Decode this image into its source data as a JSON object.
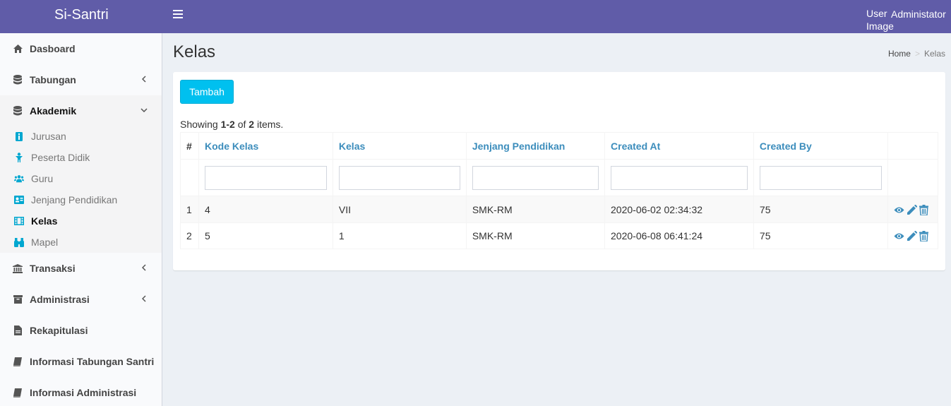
{
  "app": {
    "brand": "Si-Santri",
    "user_image_alt": "User Image",
    "user_name": "Administator"
  },
  "colors": {
    "header": "#605ca8",
    "accent": "#3c8dbc",
    "button": "#00c0ef"
  },
  "sidebar": {
    "items": [
      {
        "label": "Dasboard",
        "icon": "home-icon"
      },
      {
        "label": "Tabungan",
        "icon": "database-icon",
        "chevron": "left"
      },
      {
        "label": "Akademik",
        "icon": "database-icon",
        "chevron": "down"
      },
      {
        "label": "Transaksi",
        "icon": "bank-icon",
        "chevron": "left"
      },
      {
        "label": "Administrasi",
        "icon": "archive-icon",
        "chevron": "left"
      },
      {
        "label": "Rekapitulasi",
        "icon": "file-icon"
      },
      {
        "label": "Informasi Tabungan Santri",
        "icon": "book-icon"
      },
      {
        "label": "Informasi Administrasi",
        "icon": "book-icon"
      }
    ],
    "submenu": [
      {
        "label": "Jurusan",
        "icon": "info-icon"
      },
      {
        "label": "Peserta Didik",
        "icon": "child-icon"
      },
      {
        "label": "Guru",
        "icon": "users-icon"
      },
      {
        "label": "Jenjang Pendidikan",
        "icon": "id-card-icon"
      },
      {
        "label": "Kelas",
        "icon": "film-icon",
        "active": true
      },
      {
        "label": "Mapel",
        "icon": "binoculars-icon"
      }
    ]
  },
  "page": {
    "title": "Kelas",
    "breadcrumb": {
      "home": "Home",
      "current": "Kelas"
    }
  },
  "box": {
    "add_button": "Tambah",
    "summary": {
      "prefix": "Showing ",
      "range": "1-2",
      "of": " of ",
      "total": "2",
      "suffix": " items."
    }
  },
  "table": {
    "headers": [
      "#",
      "Kode Kelas",
      "Kelas",
      "Jenjang Pendidikan",
      "Created At",
      "Created By"
    ],
    "rows": [
      [
        "1",
        "4",
        "VII",
        "SMK-RM",
        "2020-06-02 02:34:32",
        "75"
      ],
      [
        "2",
        "5",
        "1",
        "SMK-RM",
        "2020-06-08 06:41:24",
        "75"
      ]
    ],
    "action_icons": [
      "eye-icon",
      "pencil-icon",
      "trash-icon"
    ]
  }
}
